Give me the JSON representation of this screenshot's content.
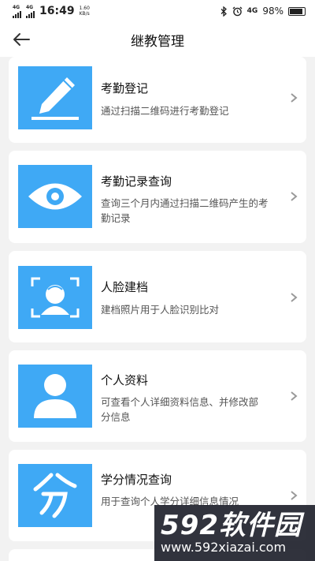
{
  "status": {
    "net_a": "4G",
    "net_b": "4G",
    "time": "16:49",
    "speed_value": "1.60",
    "speed_unit": "KB/s",
    "net_right": "4G",
    "battery": "98%"
  },
  "header": {
    "title": "继教管理"
  },
  "cards": [
    {
      "title": "考勤登记",
      "desc": "通过扫描二维码进行考勤登记",
      "icon": "pencil-icon"
    },
    {
      "title": "考勤记录查询",
      "desc": "查询三个月内通过扫描二维码产生的考勤记录",
      "icon": "eye-icon"
    },
    {
      "title": "人脸建档",
      "desc": "建档照片用于人脸识别比对",
      "icon": "face-scan-icon"
    },
    {
      "title": "个人资料",
      "desc": "可查看个人详细资料信息、并修改部分信息",
      "icon": "person-icon"
    },
    {
      "title": "学分情况查询",
      "desc": "用于查询个人学分详细信息情况",
      "icon": "credit-icon"
    }
  ],
  "watermark": {
    "big": "592软件园",
    "small": "www.592xiazai.com"
  },
  "colors": {
    "accent": "#3fa9f5",
    "background": "#f2f2f2",
    "card": "#ffffff"
  }
}
